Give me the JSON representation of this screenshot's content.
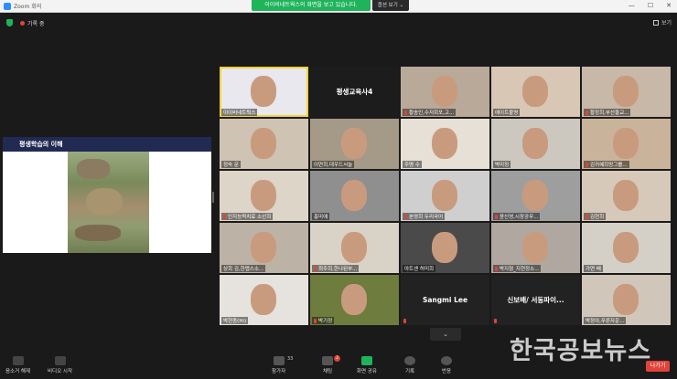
{
  "window": {
    "title": "Zoom 회의",
    "min": "—",
    "max": "☐",
    "close": "✕"
  },
  "banner": {
    "text": "이이비네트웍스의 화면을 보고 있습니다.",
    "view_options": "옵션 보기 ⌄"
  },
  "recording": {
    "label": "기록 중",
    "view_label": "보기"
  },
  "share": {
    "slide_title": "평생학습의 이해"
  },
  "grid": {
    "tiles": [
      {
        "name": "이이비네트웍스",
        "muted": false,
        "active": true,
        "center": ""
      },
      {
        "name": "",
        "muted": false,
        "active": false,
        "center": "평생교육사4"
      },
      {
        "name": "황송인,수저회포,고...",
        "muted": true,
        "active": false,
        "center": ""
      },
      {
        "name": "에이트불명",
        "muted": false,
        "active": false,
        "center": ""
      },
      {
        "name": "황정희,부산울교...",
        "muted": true,
        "active": false,
        "center": ""
      },
      {
        "name": "정숙 문",
        "muted": false,
        "active": false,
        "center": ""
      },
      {
        "name": "이연희,대우드서늘",
        "muted": false,
        "active": false,
        "center": ""
      },
      {
        "name": "주명 수",
        "muted": false,
        "active": false,
        "center": ""
      },
      {
        "name": "박미정",
        "muted": false,
        "active": false,
        "center": ""
      },
      {
        "name": "김귀혜희망그룹...",
        "muted": true,
        "active": false,
        "center": ""
      },
      {
        "name": "인지능력치료 소선희",
        "muted": true,
        "active": false,
        "center": ""
      },
      {
        "name": "홍미애",
        "muted": false,
        "active": false,
        "center": ""
      },
      {
        "name": "본영희 두리국어",
        "muted": true,
        "active": false,
        "center": ""
      },
      {
        "name": "윤신영,시장공무...",
        "muted": true,
        "active": false,
        "center": ""
      },
      {
        "name": "김현희",
        "muted": true,
        "active": false,
        "center": ""
      },
      {
        "name": "상희 김,한맵스소...",
        "muted": false,
        "active": false,
        "center": ""
      },
      {
        "name": "최주희,한나된부...",
        "muted": true,
        "active": false,
        "center": ""
      },
      {
        "name": "아트센 허미희",
        "muted": false,
        "active": false,
        "center": ""
      },
      {
        "name": "박지형_지현정소...",
        "muted": true,
        "active": false,
        "center": ""
      },
      {
        "name": "가연 배",
        "muted": false,
        "active": false,
        "center": ""
      },
      {
        "name": "박현종(Hi)",
        "muted": false,
        "active": false,
        "center": ""
      },
      {
        "name": "박기정",
        "muted": true,
        "active": false,
        "center": ""
      },
      {
        "name": "",
        "muted": true,
        "active": false,
        "center": "Sangmi Lee"
      },
      {
        "name": "",
        "muted": true,
        "active": false,
        "center": "신보배/ 서동파이..."
      },
      {
        "name": "박정아,푸른자운...",
        "muted": false,
        "active": false,
        "center": ""
      }
    ],
    "next_label": "⌄"
  },
  "toolbar": {
    "mute": "음소거 해제",
    "video": "비디오 시작",
    "participants": "참가자",
    "participants_count": "33",
    "chat": "채팅",
    "chat_badge": "2",
    "share": "화면 공유",
    "record": "기록",
    "reactions": "반응",
    "leave": "나가기"
  },
  "watermark": "한국공보뉴스"
}
